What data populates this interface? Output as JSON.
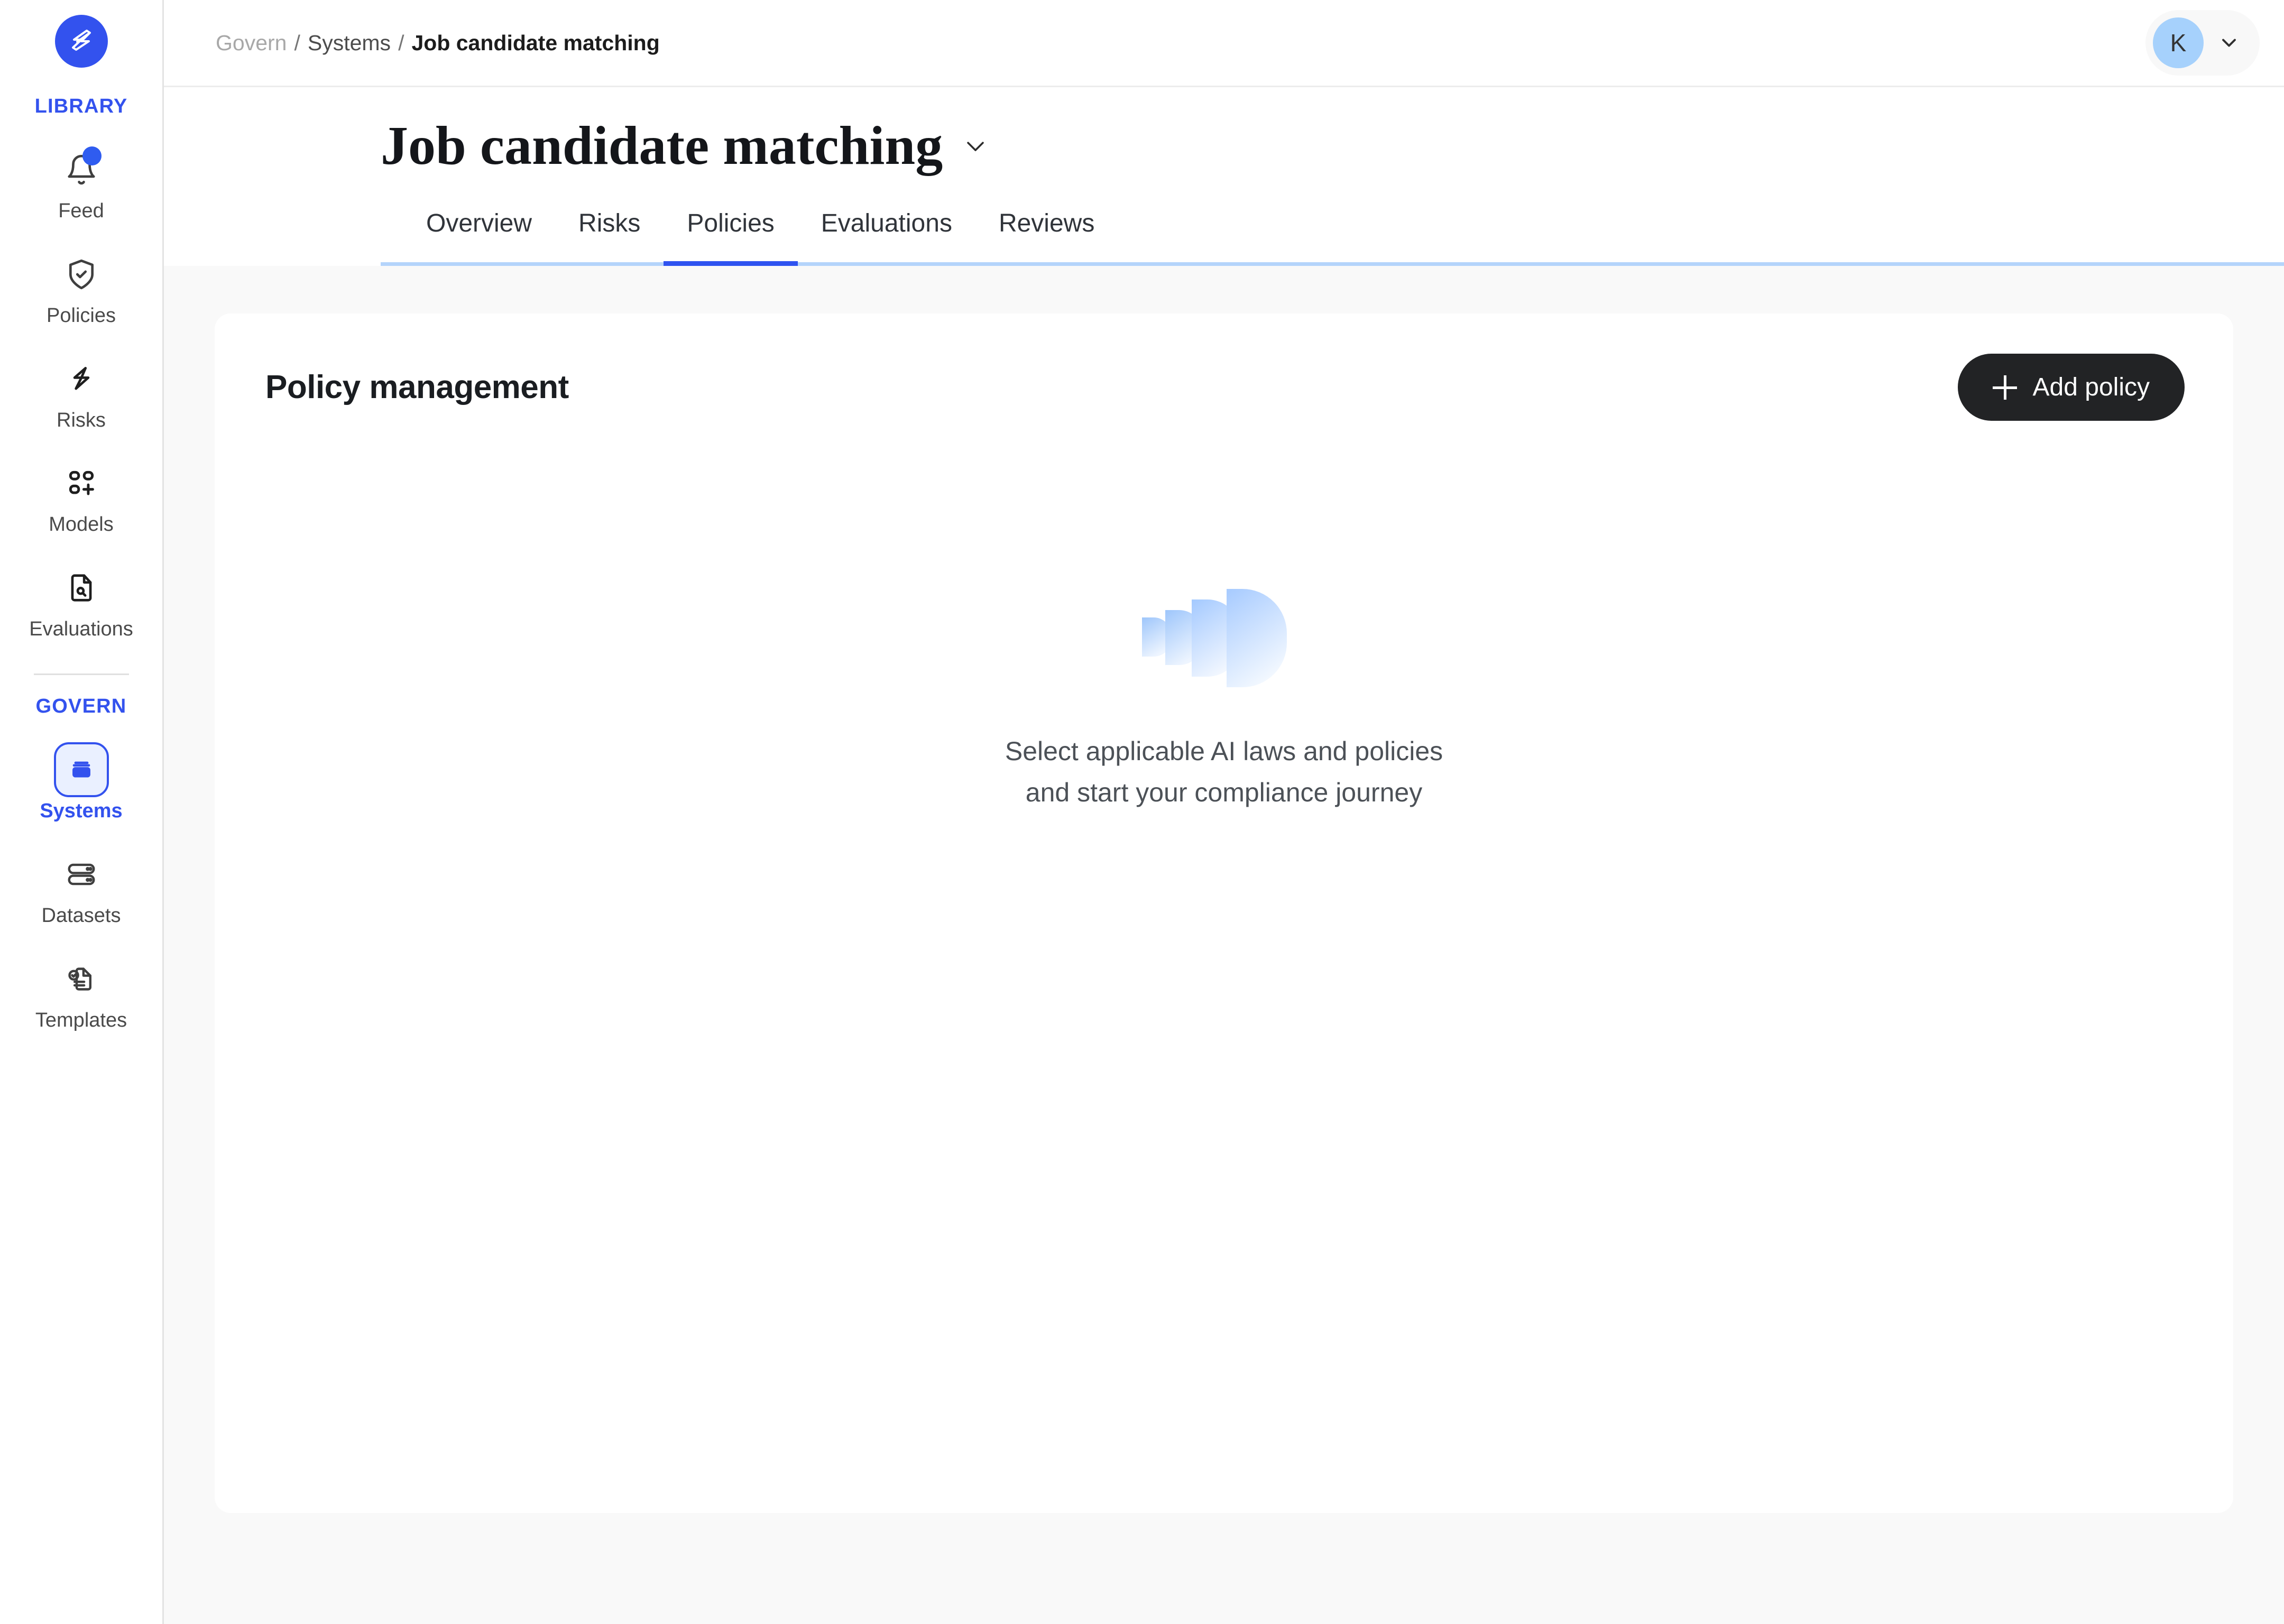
{
  "brand": {
    "logo_icon": "lightning-logo-icon",
    "accent_color": "#3352ee",
    "dark_button_color": "#222325"
  },
  "sidebar": {
    "sections": [
      {
        "label": "LIBRARY",
        "items": [
          {
            "label": "Feed",
            "icon": "bell-icon",
            "active": false,
            "badge": true
          },
          {
            "label": "Policies",
            "icon": "shield-check-icon",
            "active": false,
            "badge": false
          },
          {
            "label": "Risks",
            "icon": "lightning-bolt-icon",
            "active": false,
            "badge": false
          },
          {
            "label": "Models",
            "icon": "grid-plus-icon",
            "active": false,
            "badge": false
          },
          {
            "label": "Evaluations",
            "icon": "document-search-icon",
            "active": false,
            "badge": false
          }
        ]
      },
      {
        "label": "GOVERN",
        "items": [
          {
            "label": "Systems",
            "icon": "archive-box-icon",
            "active": true,
            "badge": false
          },
          {
            "label": "Datasets",
            "icon": "database-stack-icon",
            "active": false,
            "badge": false
          },
          {
            "label": "Templates",
            "icon": "document-check-icon",
            "active": false,
            "badge": false
          }
        ]
      }
    ]
  },
  "topbar": {
    "breadcrumb": {
      "root": "Govern",
      "separator": "/",
      "middle": "Systems",
      "current": "Job candidate matching"
    },
    "user": {
      "initial": "K",
      "chevron_icon": "chevron-down-icon"
    }
  },
  "page": {
    "title": "Job candidate matching",
    "title_chevron_icon": "chevron-down-icon",
    "tabs": [
      {
        "label": "Overview",
        "active": false
      },
      {
        "label": "Risks",
        "active": false
      },
      {
        "label": "Policies",
        "active": true
      },
      {
        "label": "Evaluations",
        "active": false
      },
      {
        "label": "Reviews",
        "active": false
      }
    ]
  },
  "card": {
    "title": "Policy management",
    "add_button": {
      "label": "Add policy",
      "icon": "plus-icon"
    },
    "empty_state": {
      "illustration": "blue-wave-bars-illustration",
      "line1": "Select applicable AI laws and policies",
      "line2": "and start your compliance journey"
    }
  }
}
